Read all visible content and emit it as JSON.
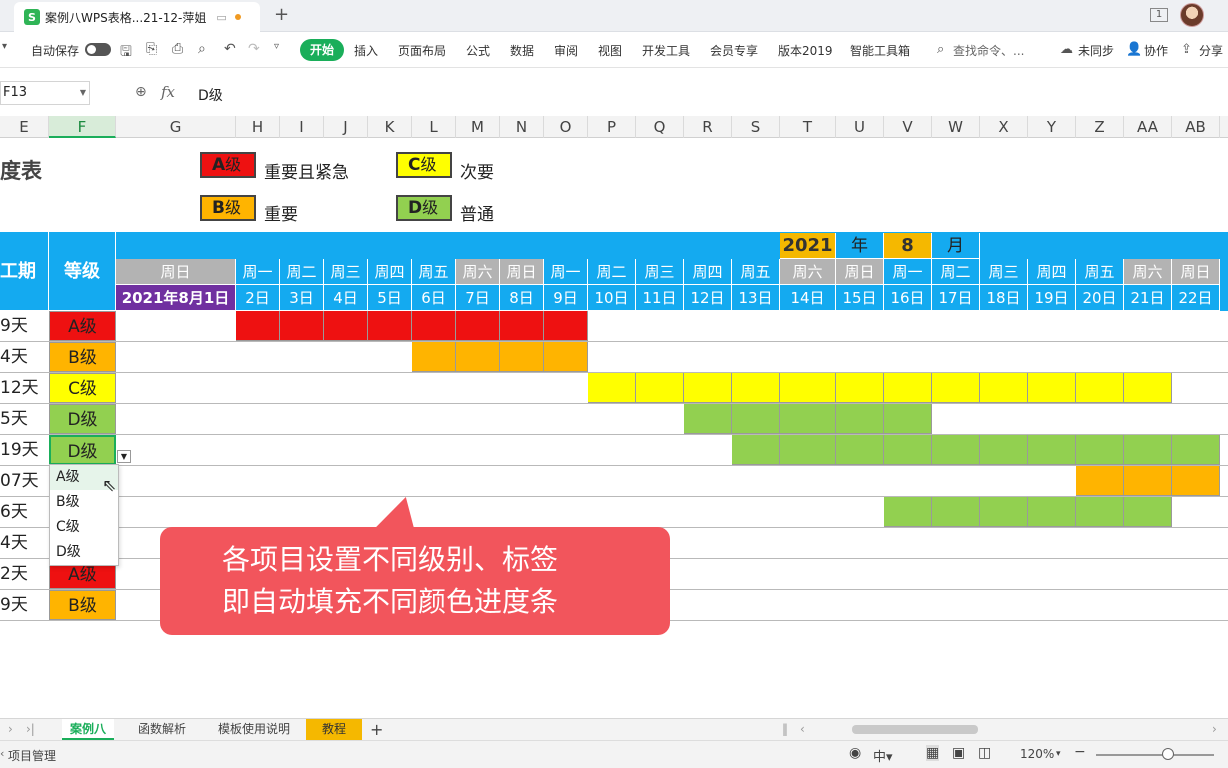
{
  "titlebar": {
    "doc_title": "案例八WPS表格...21-12-萍姐",
    "sheet_icon_letter": "S",
    "pin_icon": "pin-icon",
    "window_num": "1"
  },
  "toolbar": {
    "autosave": "自动保存",
    "menu": [
      "开始",
      "插入",
      "页面布局",
      "公式",
      "数据",
      "审阅",
      "视图",
      "开发工具",
      "会员专享",
      "版本2019",
      "智能工具箱"
    ],
    "search": "查找命令、...",
    "sync": "未同步",
    "collab": "协作",
    "share": "分享",
    "icons": [
      "save-icon",
      "export-icon",
      "print-icon",
      "preview-icon",
      "undo-icon",
      "redo-icon",
      "more-icon"
    ]
  },
  "formula_bar": {
    "name_box": "F13",
    "fx": "fx",
    "value": "D级"
  },
  "columns": [
    "E",
    "F",
    "G",
    "H",
    "I",
    "J",
    "K",
    "L",
    "M",
    "N",
    "O",
    "P",
    "Q",
    "R",
    "S",
    "T",
    "U",
    "V",
    "W",
    "X",
    "Y",
    "Z",
    "AA",
    "AB"
  ],
  "legend": {
    "title": "度表",
    "items": [
      {
        "box": "A",
        "box_suffix": "级",
        "text": "重要且紧急",
        "color": "#ee1111"
      },
      {
        "box": "C",
        "box_suffix": "级",
        "text": "次要",
        "color": "#ffff00"
      },
      {
        "box": "B",
        "box_suffix": "级",
        "text": "重要",
        "color": "#ffb400"
      },
      {
        "box": "D",
        "box_suffix": "级",
        "text": "普通",
        "color": "#92d050"
      }
    ]
  },
  "header": {
    "duration_label": "工期",
    "grade_label": "等级",
    "year": "2021",
    "year_unit": "年",
    "month": "8",
    "month_unit": "月",
    "weekdays": [
      "周日",
      "周一",
      "周二",
      "周三",
      "周四",
      "周五",
      "周六",
      "周日",
      "周一",
      "周二",
      "周三",
      "周四",
      "周五",
      "周六",
      "周日",
      "周一",
      "周二",
      "周三",
      "周四",
      "周五",
      "周六",
      "周日"
    ],
    "dates": [
      "2021年8月1日",
      "2日",
      "3日",
      "4日",
      "5日",
      "6日",
      "7日",
      "8日",
      "9日",
      "10日",
      "11日",
      "12日",
      "13日",
      "14日",
      "15日",
      "16日",
      "17日",
      "18日",
      "19日",
      "20日",
      "21日",
      "22日"
    ]
  },
  "rows": [
    {
      "duration": "9天",
      "grade": "A级"
    },
    {
      "duration": "4天",
      "grade": "B级"
    },
    {
      "duration": "12天",
      "grade": "C级"
    },
    {
      "duration": "5天",
      "grade": "D级"
    },
    {
      "duration": "19天",
      "grade": "D级"
    },
    {
      "duration": "07天",
      "grade": ""
    },
    {
      "duration": "6天",
      "grade": ""
    },
    {
      "duration": "4天",
      "grade": ""
    },
    {
      "duration": "2天",
      "grade": "A级"
    },
    {
      "duration": "9天",
      "grade": "B级"
    }
  ],
  "dropdown": {
    "options": [
      "A级",
      "B级",
      "C级",
      "D级"
    ]
  },
  "callout": {
    "line1": "各项目设置不同级别、标签",
    "line2": "即自动填充不同颜色进度条"
  },
  "sheet_tabs": [
    "案例八",
    "函数解析",
    "模板使用说明",
    "教程"
  ],
  "status": {
    "mode": "项目管理",
    "zoom": "120%"
  },
  "colors": {
    "header_blue": "#14aaf0",
    "weekend_grey": "#b3b3b3",
    "gold": "#f5b800",
    "purple": "#7030a0",
    "A": "#ee1111",
    "B": "#ffb400",
    "C": "#ffff00",
    "D": "#92d050"
  }
}
